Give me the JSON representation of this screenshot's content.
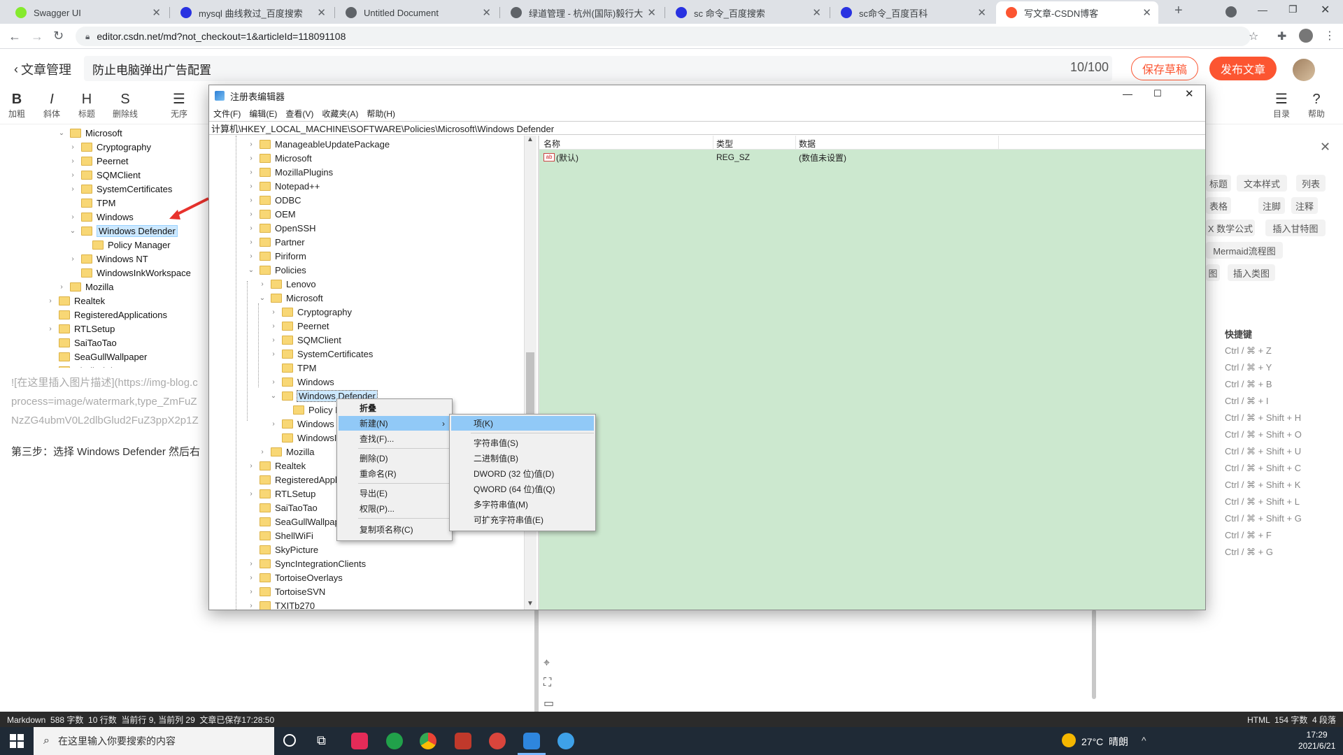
{
  "browser": {
    "tabs": [
      {
        "label": "Swagger UI",
        "icon": "swagger-icon",
        "color": "#85ea2d"
      },
      {
        "label": "mysql 曲线救过_百度搜索",
        "icon": "baidu-icon",
        "color": "#2932e1"
      },
      {
        "label": "Untitled Document",
        "icon": "globe-icon",
        "color": "#5f6368"
      },
      {
        "label": "绿道管理 - 杭州(国际)毅行大会(",
        "icon": "globe-icon",
        "color": "#5f6368"
      },
      {
        "label": "sc 命令_百度搜索",
        "icon": "baidu-icon",
        "color": "#2932e1"
      },
      {
        "label": "sc命令_百度百科",
        "icon": "baidu-icon",
        "color": "#2932e1"
      },
      {
        "label": "写文章-CSDN博客",
        "icon": "csdn-icon",
        "color": "#fc5531"
      }
    ],
    "url": "editor.csdn.net/md?not_checkout=1&articleId=118091108"
  },
  "editor": {
    "back_label": "文章管理",
    "title": "防止电脑弹出广告配置",
    "title_count": "10/100",
    "save_draft": "保存草稿",
    "publish": "发布文章",
    "toolbar": [
      {
        "g": "B",
        "label": "加粗"
      },
      {
        "g": "I",
        "label": "斜体"
      },
      {
        "g": "H",
        "label": "标题"
      },
      {
        "g": "S",
        "label": "删除线"
      },
      {
        "g": "☰",
        "label": "无序"
      }
    ],
    "toolbar_right": [
      {
        "g": "☰",
        "label": "目录"
      },
      {
        "g": "?",
        "label": "帮助"
      }
    ],
    "content_lines": [
      "![在这里插入图片描述](https://img-blog.c",
      "process=image/watermark,type_ZmFuZ",
      "NzZG4ubmV0L2dlbGlud2FuZ3ppX2p1Z"
    ],
    "step_text": "第三步：选择 Windows Defender  然后右",
    "preview_tree": [
      {
        "label": "Microsoft",
        "indent": 0,
        "expanded": true
      },
      {
        "label": "Cryptography",
        "indent": 1,
        "expanded": false
      },
      {
        "label": "Peernet",
        "indent": 1,
        "expanded": false
      },
      {
        "label": "SQMClient",
        "indent": 1,
        "expanded": false
      },
      {
        "label": "SystemCertificates",
        "indent": 1,
        "expanded": false
      },
      {
        "label": "TPM",
        "indent": 1,
        "expanded": null
      },
      {
        "label": "Windows",
        "indent": 1,
        "expanded": false
      },
      {
        "label": "Windows Defender",
        "indent": 1,
        "expanded": true,
        "selected": true
      },
      {
        "label": "Policy Manager",
        "indent": 2,
        "expanded": null
      },
      {
        "label": "Windows NT",
        "indent": 1,
        "expanded": false
      },
      {
        "label": "WindowsInkWorkspace",
        "indent": 1,
        "expanded": null
      },
      {
        "label": "Mozilla",
        "indent": 0,
        "expanded": false
      },
      {
        "label": "Realtek",
        "indent": -1,
        "expanded": false
      },
      {
        "label": "RegisteredApplications",
        "indent": -1,
        "expanded": null
      },
      {
        "label": "RTLSetup",
        "indent": -1,
        "expanded": false
      },
      {
        "label": "SaiTaoTao",
        "indent": -1,
        "expanded": null
      },
      {
        "label": "SeaGullWallpaper",
        "indent": -1,
        "expanded": null
      },
      {
        "label": "ShellWiFi",
        "indent": -1,
        "expanded": null
      }
    ]
  },
  "right_panel": {
    "chips_row1": [
      "标题",
      "文本样式",
      "列表"
    ],
    "chips_row2": [
      "表格",
      "注脚",
      "注释"
    ],
    "chips_row3": [
      "X 数学公式",
      "插入甘特图"
    ],
    "chips_row4": [
      "Mermaid流程图"
    ],
    "chips_row5": [
      "图",
      "插入类图"
    ],
    "shortcuts_title": "快捷键",
    "shortcuts": [
      "Ctrl / ⌘ + Z",
      "Ctrl / ⌘ + Y",
      "Ctrl / ⌘ + B",
      "Ctrl / ⌘ + I",
      "Ctrl / ⌘ + Shift + H",
      "Ctrl / ⌘ + Shift + O",
      "Ctrl / ⌘ + Shift + U",
      "Ctrl / ⌘ + Shift + C",
      "Ctrl / ⌘ + Shift + K",
      "Ctrl / ⌘ + Shift + L",
      "Ctrl / ⌘ + Shift + G",
      "Ctrl / ⌘ + F",
      "Ctrl / ⌘ + G"
    ]
  },
  "regedit": {
    "title": "注册表编辑器",
    "menu": [
      "文件(F)",
      "编辑(E)",
      "查看(V)",
      "收藏夹(A)",
      "帮助(H)"
    ],
    "path": "计算机\\HKEY_LOCAL_MACHINE\\SOFTWARE\\Policies\\Microsoft\\Windows Defender",
    "tree": [
      {
        "label": "ManageableUpdatePackage",
        "level": 0,
        "exp": false
      },
      {
        "label": "Microsoft",
        "level": 0,
        "exp": false
      },
      {
        "label": "MozillaPlugins",
        "level": 0,
        "exp": false
      },
      {
        "label": "Notepad++",
        "level": 0,
        "exp": false
      },
      {
        "label": "ODBC",
        "level": 0,
        "exp": false
      },
      {
        "label": "OEM",
        "level": 0,
        "exp": false
      },
      {
        "label": "OpenSSH",
        "level": 0,
        "exp": false
      },
      {
        "label": "Partner",
        "level": 0,
        "exp": false
      },
      {
        "label": "Piriform",
        "level": 0,
        "exp": false
      },
      {
        "label": "Policies",
        "level": 0,
        "exp": true
      },
      {
        "label": "Lenovo",
        "level": 1,
        "exp": false
      },
      {
        "label": "Microsoft",
        "level": 1,
        "exp": true
      },
      {
        "label": "Cryptography",
        "level": 2,
        "exp": false
      },
      {
        "label": "Peernet",
        "level": 2,
        "exp": false
      },
      {
        "label": "SQMClient",
        "level": 2,
        "exp": false
      },
      {
        "label": "SystemCertificates",
        "level": 2,
        "exp": false
      },
      {
        "label": "TPM",
        "level": 2,
        "exp": null
      },
      {
        "label": "Windows",
        "level": 2,
        "exp": false
      },
      {
        "label": "Windows Defender",
        "level": 2,
        "exp": true,
        "selected": true
      },
      {
        "label": "Policy M",
        "level": 3,
        "exp": null
      },
      {
        "label": "Windows I",
        "level": 2,
        "exp": false
      },
      {
        "label": "WindowsI",
        "level": 2,
        "exp": null
      },
      {
        "label": "Mozilla",
        "level": 1,
        "exp": false
      },
      {
        "label": "Realtek",
        "level": 0,
        "exp": false
      },
      {
        "label": "RegisteredAppl",
        "level": 0,
        "exp": null
      },
      {
        "label": "RTLSetup",
        "level": 0,
        "exp": false
      },
      {
        "label": "SaiTaoTao",
        "level": 0,
        "exp": null
      },
      {
        "label": "SeaGullWallpap",
        "level": 0,
        "exp": null
      },
      {
        "label": "ShellWiFi",
        "level": 0,
        "exp": null
      },
      {
        "label": "SkyPicture",
        "level": 0,
        "exp": null
      },
      {
        "label": "SyncIntegrationClients",
        "level": 0,
        "exp": false
      },
      {
        "label": "TortoiseOverlays",
        "level": 0,
        "exp": false
      },
      {
        "label": "TortoiseSVN",
        "level": 0,
        "exp": false
      },
      {
        "label": "TXITb270",
        "level": 0,
        "exp": false
      }
    ],
    "columns": [
      "名称",
      "类型",
      "数据"
    ],
    "values": [
      {
        "name": "(默认)",
        "type": "REG_SZ",
        "data": "(数值未设置)"
      }
    ],
    "context_menu": [
      "折叠",
      "新建(N)",
      "查找(F)...",
      "删除(D)",
      "重命名(R)",
      "导出(E)",
      "权限(P)...",
      "复制项名称(C)"
    ],
    "submenu": [
      "项(K)",
      "字符串值(S)",
      "二进制值(B)",
      "DWORD (32 位)值(D)",
      "QWORD (64 位)值(Q)",
      "多字符串值(M)",
      "可扩充字符串值(E)"
    ]
  },
  "status": {
    "left": "Markdown  588 字数  10 行数  当前行 9, 当前列 29  文章已保存17:28:50",
    "right": "HTML  154 字数  4 段落"
  },
  "taskbar": {
    "search_placeholder": "在这里输入你要搜索的内容",
    "weather": "27°C  晴朗",
    "time": "17:29",
    "date": "2021/6/21"
  }
}
